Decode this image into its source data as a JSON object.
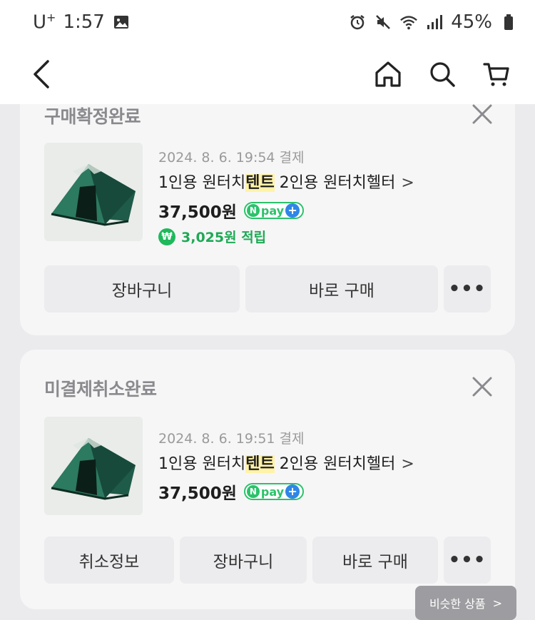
{
  "status_bar": {
    "carrier": "U",
    "carrier_sup": "+",
    "time": "1:57",
    "battery": "45%",
    "icons": [
      "image-icon",
      "alarm-icon",
      "mute-icon",
      "wifi-icon",
      "signal-icon",
      "battery-icon"
    ]
  },
  "nav": {
    "icons": [
      "back-icon",
      "home-icon",
      "search-icon",
      "cart-icon"
    ]
  },
  "orders": [
    {
      "status": "구매확정완료",
      "date": "2024. 8. 6. 19:54 결제",
      "name_before": "1인용 원터치",
      "name_highlight": "텐트",
      "name_after": " 2인용 원터치헬터",
      "chevron": ">",
      "price": "37,500원",
      "npay_n": "N",
      "npay_label": "pay",
      "npay_plus": "+",
      "points_icon": "₩",
      "points": "3,025원 적립",
      "buttons": [
        "장바구니",
        "바로 구매"
      ],
      "more": "•••"
    },
    {
      "status": "미결제취소완료",
      "date": "2024. 8. 6. 19:51 결제",
      "name_before": "1인용 원터치",
      "name_highlight": "텐트",
      "name_after": " 2인용 원터치헬터",
      "chevron": ">",
      "price": "37,500원",
      "npay_n": "N",
      "npay_label": "pay",
      "npay_plus": "+",
      "buttons": [
        "취소정보",
        "장바구니",
        "바로 구매"
      ],
      "more": "•••"
    }
  ],
  "floating": {
    "similar_label": "비슷한 상품",
    "chevron": ">"
  },
  "colors": {
    "background": "#ebebee",
    "card": "#f6f6f7",
    "npay_green": "#2bc26a",
    "points_green": "#1fa956",
    "highlight": "#fff3a8"
  }
}
